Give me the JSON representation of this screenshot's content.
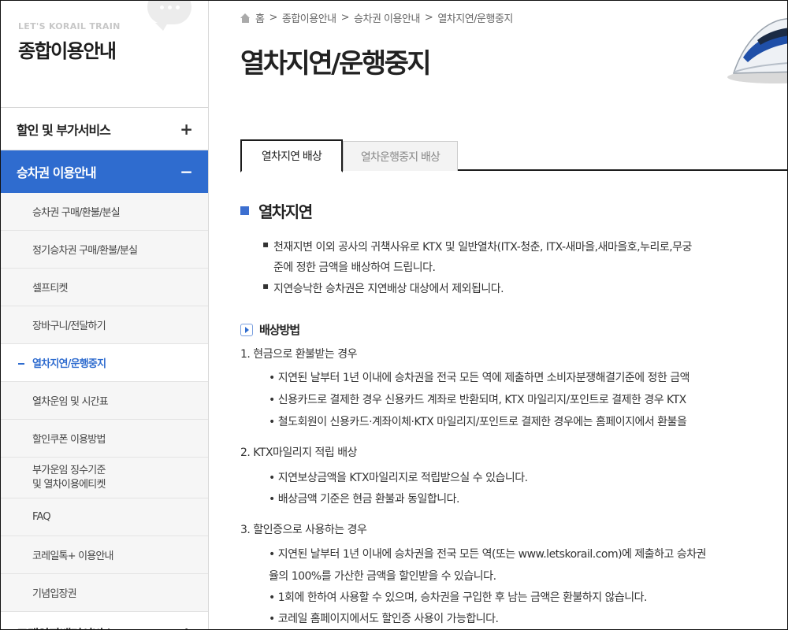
{
  "sidebar": {
    "brand_small": "LET'S KORAIL TRAIN",
    "brand_title": "종합이용안내",
    "categories": [
      {
        "label": "할인 및 부가서비스",
        "toggle": "+"
      },
      {
        "label": "승차권 이용안내",
        "toggle": "−"
      }
    ],
    "subitems": [
      "승차권 구매/환불/분실",
      "정기승차권 구매/환불/분실",
      "셀프티켓",
      "장바구니/전달하기",
      "열차지연/운행중지",
      "열차운임 및 시간표",
      "할인쿠폰 이용방법",
      "부가운임 징수기준",
      "및 열차이용에티켓",
      "FAQ",
      "코레일톡+ 이용안내",
      "기념입장권"
    ],
    "last_category": {
      "label": "고객약자배려서비스",
      "toggle": "+"
    }
  },
  "breadcrumb": {
    "items": [
      "홈",
      ">",
      "종합이용안내",
      ">",
      "승차권 이용안내",
      ">",
      "열차지연/운행중지"
    ]
  },
  "page_title": "열차지연/운행중지",
  "tabs": [
    "열차지연 배상",
    "열차운행중지 배상"
  ],
  "section": {
    "heading": "열차지연",
    "intro": [
      "천재지변 이외 공사의 귀책사유로 KTX 및 일반열차(ITX-청춘, ITX-새마을,새마을호,누리로,무궁",
      "준에 정한 금액을 배상하여 드립니다.",
      "지연승낙한 승차권은 지연배상 대상에서 제외됩니다."
    ],
    "method_heading": "배상방법",
    "groups": [
      {
        "title": "1. 현금으로 환불받는 경우",
        "lines": [
          "• 지연된 날부터 1년 이내에 승차권을 전국 모든 역에 제출하면 소비자분쟁해결기준에 정한 금액",
          "• 신용카드로 결제한 경우 신용카드 계좌로 반환되며, KTX 마일리지/포인트로 결제한 경우 KTX",
          "• 철도회원이 신용카드·계좌이체·KTX 마일리지/포인트로 결제한 경우에는 홈페이지에서 환불을"
        ]
      },
      {
        "title": "2. KTX마일리지 적립 배상",
        "lines": [
          "• 지연보상금액을 KTX마일리지로 적립받으실 수 있습니다.",
          "• 배상금액 기준은 현금 환불과 동일합니다."
        ]
      },
      {
        "title": "3. 할인증으로 사용하는 경우",
        "lines": [
          "• 지연된 날부터 1년 이내에 승차권을 전국 모든 역(또는 www.letskorail.com)에 제출하고 승차권",
          "율의 100%를 가산한 금액을 할인받을 수 있습니다.",
          "• 1회에 한하여 사용할 수 있으며, 승차권을 구입한 후 남는 금액은 환불하지 않습니다.",
          "• 코레일 홈페이지에서도 할인증 사용이 가능합니다."
        ]
      }
    ]
  },
  "colors": {
    "accent": "#2f6ccf",
    "heading_square": "#3c6fd0"
  }
}
